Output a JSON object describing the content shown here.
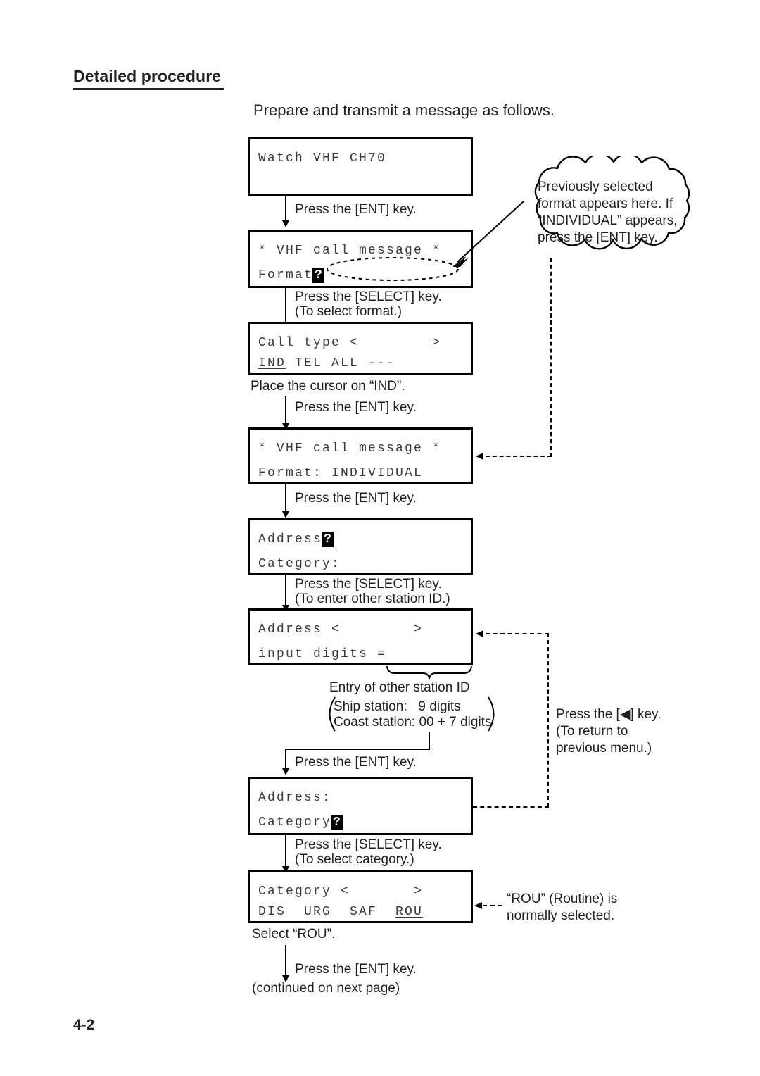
{
  "page": {
    "section_title": "Detailed procedure",
    "intro": "Prepare and transmit a message as follows.",
    "folio": "4-2"
  },
  "screens": [
    {
      "id": "watch-vhf",
      "line1": "Watch VHF CH70",
      "line2": ""
    },
    {
      "id": "vhf-call-message-format-prompt",
      "line1": "* VHF call message *",
      "line2_prefix": "Format",
      "line2_cursor": "?"
    },
    {
      "id": "call-type-select",
      "line1": "Call type <        >",
      "line2_selected": "IND",
      "line2_rest": " TEL ALL ---"
    },
    {
      "id": "vhf-call-message-format-individual",
      "line1": "* VHF call message *",
      "line2": "Format: INDIVIDUAL"
    },
    {
      "id": "address-category-prompt",
      "line1_prefix": "Address",
      "line1_cursor": "?",
      "line2": "Category:"
    },
    {
      "id": "address-input-digits",
      "line1": "Address <        >",
      "line2": "input digits ="
    },
    {
      "id": "address-category-cursor",
      "line1": "Address:",
      "line2_prefix": "Category",
      "line2_cursor": "?"
    },
    {
      "id": "category-select",
      "line1": "Category <       >",
      "line2_options": "DIS  URG  SAF  ",
      "line2_selected": "ROU"
    }
  ],
  "steps": {
    "ent_1": "Press the [ENT] key.",
    "select_format": "Press the [SELECT] key.",
    "select_format_sub": "(To select format.)",
    "place_cursor_ind": "Place the cursor on “IND”.",
    "ent_2": "Press the [ENT] key.",
    "ent_3": "Press the [ENT] key.",
    "select_station_id": "Press the [SELECT] key.",
    "select_station_id_sub": "(To enter other station ID.)",
    "ent_4": "Press the [ENT] key.",
    "select_category": "Press the [SELECT] key.",
    "select_category_sub": "(To select category.)",
    "select_rou": "Select “ROU”.",
    "ent_5": "Press the [ENT] key.",
    "continued": "(continued on next page)"
  },
  "callouts": {
    "cloud": "Previously selected\nformat appears here. If\n“INDIVIDUAL” appears,\npress the [ENT] key.",
    "entry_label": "Entry of other station ID",
    "entry_paren_line1": "Ship station:   9 digits",
    "entry_paren_line2": "Coast station: 00 + 7 digits",
    "back_key": "Press the [◀] key.\n(To return to\nprevious menu.)",
    "rou_note": "“ROU” (Routine) is\nnormally selected."
  },
  "colors": {
    "ink": "#231f20",
    "lcd_text": "#3a3a3a",
    "rule": "#000000"
  }
}
